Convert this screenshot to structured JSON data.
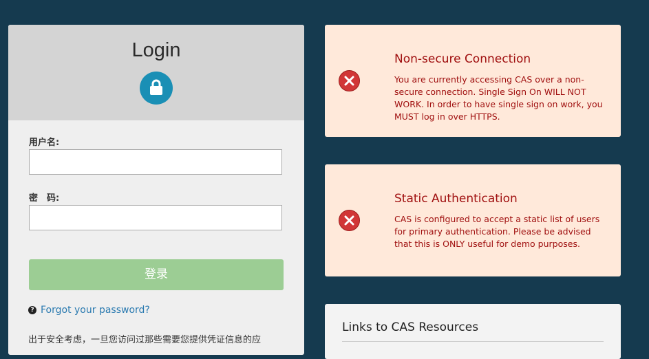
{
  "login": {
    "title": "Login",
    "username_label": "用户名:",
    "username_value": "",
    "password_label": "密　码:",
    "password_value": "",
    "submit_label": "登录",
    "forgot_label": "Forgot your password?",
    "security_notice": "出于安全考虑，一旦您访问过那些需要您提供凭证信息的应"
  },
  "alerts": [
    {
      "title": "Non-secure Connection",
      "body": "You are currently accessing CAS over a non-secure connection. Single Sign On WILL NOT WORK. In order to have single sign on work, you MUST log in over HTTPS."
    },
    {
      "title": "Static Authentication",
      "body": "CAS is configured to accept a static list of users for primary authentication. Please be advised that this is ONLY useful for demo purposes."
    }
  ],
  "links": {
    "title": "Links to CAS Resources"
  },
  "icons": {
    "lock": "lock-icon",
    "error": "error-x-icon",
    "question": "question-circle-icon"
  },
  "colors": {
    "background": "#153a4f",
    "accent": "#1a8fb5",
    "submit": "#9ccd94",
    "alert_bg": "#ffe9da",
    "alert_text": "#a01010"
  }
}
